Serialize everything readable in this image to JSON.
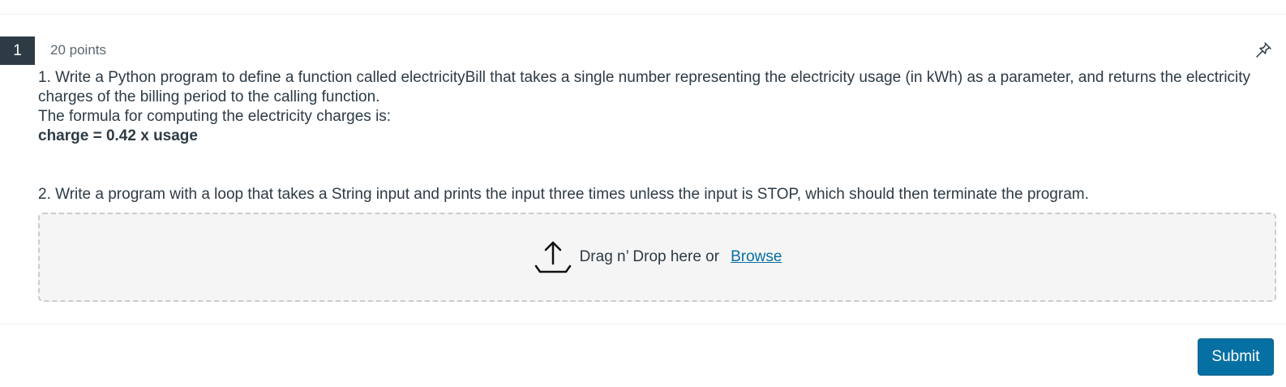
{
  "question": {
    "number": "1",
    "points": "20 points",
    "pin_icon": "pin-icon",
    "part1_line1": "1. Write a Python program to define a function called electricityBill that takes a single number representing the electricity usage (in kWh) as a parameter, and returns the electricity charges of the billing period to the calling function.",
    "part1_line2": "The formula for computing the electricity charges is:",
    "formula": "charge = 0.42 x usage",
    "part2": "2. Write a program with a loop that takes a String input and prints the input three times unless the input is STOP, which should then terminate the program."
  },
  "upload": {
    "icon": "upload-icon",
    "drop_text": "Drag n’ Drop here or",
    "browse_label": "Browse"
  },
  "footer": {
    "submit_label": "Submit"
  },
  "colors": {
    "accent": "#0770a3",
    "number_badge": "#2d3b45",
    "text": "#2d3b45",
    "dropzone_bg": "#f5f5f5"
  }
}
